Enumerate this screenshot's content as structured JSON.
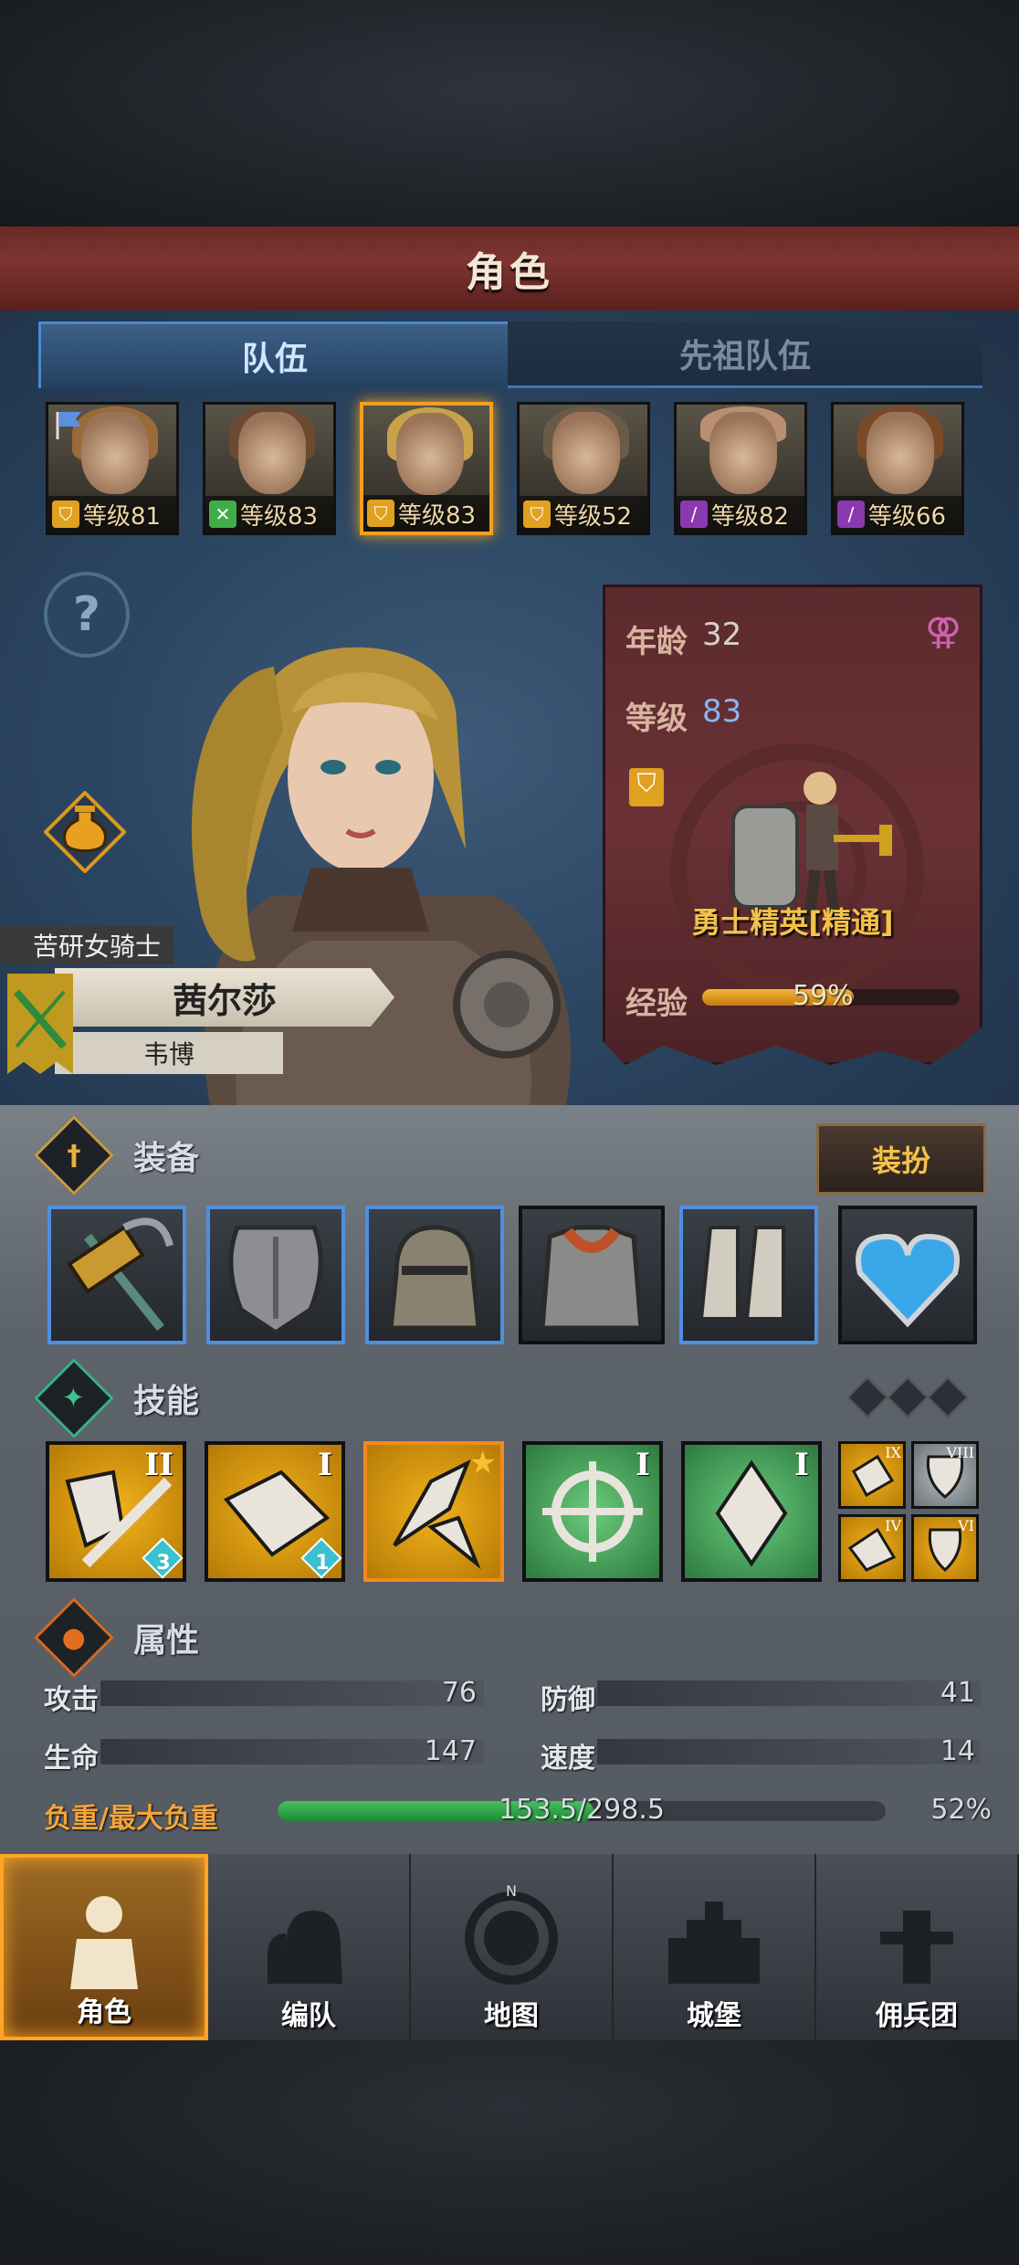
{
  "header": {
    "title": "角色"
  },
  "tabs": [
    {
      "label": "队伍",
      "active": true
    },
    {
      "label": "先祖队伍",
      "active": false
    }
  ],
  "heroes": [
    {
      "class_icon": "shield-icon",
      "class_color": "#e0a020",
      "level": "等级81",
      "hair": "#9a6a3a"
    },
    {
      "class_icon": "bow-icon",
      "class_color": "#3fae4a",
      "level": "等级83",
      "hair": "#6a4a30"
    },
    {
      "class_icon": "shield-star-icon",
      "class_color": "#e0a020",
      "level": "等级83",
      "hair": "#c8a24a"
    },
    {
      "class_icon": "shield-icon",
      "class_color": "#e0a020",
      "level": "等级52",
      "hair": "#6a5a48"
    },
    {
      "class_icon": "staff-icon",
      "class_color": "#8a3ab0",
      "level": "等级82",
      "hair": "#b89070"
    },
    {
      "class_icon": "staff-icon",
      "class_color": "#8a3ab0",
      "level": "等级66",
      "hair": "#7a4a28"
    }
  ],
  "character": {
    "title": "苦研女骑士",
    "name": "茜尔莎",
    "house": "韦博",
    "age_label": "年龄",
    "age": "32",
    "level_label": "等级",
    "level": "83",
    "gender_icon": "female-icon",
    "class_name": "勇士精英[精通]",
    "exp_label": "经验",
    "exp_percent": 59,
    "exp_text": "59%"
  },
  "equipment": {
    "title": "装备",
    "dress_button": "装扮",
    "slots": [
      {
        "icon": "war-hammer-icon",
        "highlight": true
      },
      {
        "icon": "shield-icon",
        "highlight": true
      },
      {
        "icon": "helmet-icon",
        "highlight": true
      },
      {
        "icon": "chainmail-armor-icon",
        "highlight": false
      },
      {
        "icon": "greaves-icon",
        "highlight": true
      },
      {
        "icon": "heart-amulet-icon",
        "highlight": false
      }
    ]
  },
  "skills": {
    "title": "技能",
    "items": [
      {
        "icon": "shield-sword-icon",
        "rank": "II",
        "badge": "3",
        "color": "gold"
      },
      {
        "icon": "shield-bash-icon",
        "rank": "I",
        "badge": "1",
        "color": "gold"
      },
      {
        "icon": "charge-strike-icon",
        "rank": "",
        "badge": "",
        "color": "gold",
        "starred": true
      },
      {
        "icon": "crosshair-icon",
        "rank": "I",
        "badge": "",
        "color": "green"
      },
      {
        "icon": "crystal-icon",
        "rank": "I",
        "badge": "",
        "color": "green"
      }
    ],
    "passives": [
      {
        "icon": "passive-shield-icon",
        "rank": "IX",
        "color": "gold"
      },
      {
        "icon": "passive-shield-plus-icon",
        "rank": "VIII",
        "color": "grey"
      },
      {
        "icon": "passive-bash-icon",
        "rank": "IV",
        "color": "gold"
      },
      {
        "icon": "passive-guard-icon",
        "rank": "VI",
        "color": "gold"
      }
    ]
  },
  "attributes": {
    "title": "属性",
    "attack_label": "攻击",
    "attack": "76",
    "defense_label": "防御",
    "defense": "41",
    "hp_label": "生命",
    "hp": "147",
    "speed_label": "速度",
    "speed": "14",
    "load_label": "负重/最大负重",
    "load_text": "153.5/298.5",
    "load_percent_text": "52%",
    "load_percent": 52
  },
  "nav": [
    {
      "label": "角色",
      "icon": "knight-icon",
      "active": true
    },
    {
      "label": "编队",
      "icon": "helmet-group-icon",
      "active": false
    },
    {
      "label": "地图",
      "icon": "compass-map-icon",
      "active": false
    },
    {
      "label": "城堡",
      "icon": "castle-icon",
      "active": false
    },
    {
      "label": "佣兵团",
      "icon": "mercenary-icon",
      "active": false
    }
  ]
}
